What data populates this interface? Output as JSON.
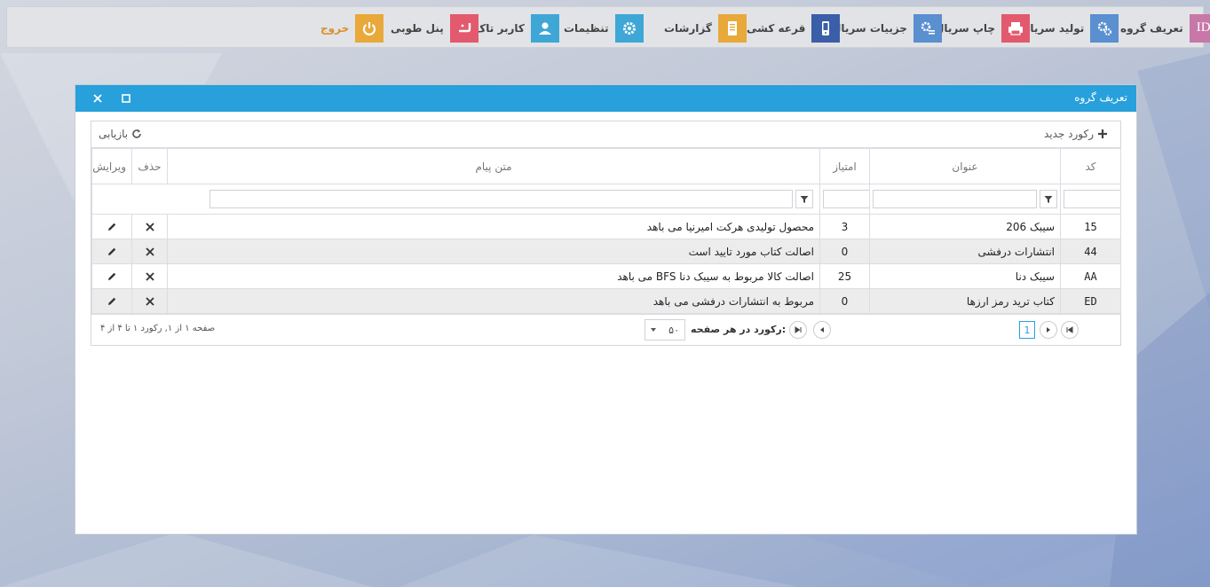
{
  "colors": {
    "window_title_bg": "#27a0dc",
    "exit_text": "#d8902a",
    "icon_group_def": "#c878a8",
    "icon_serial_prod": "#5a8fd0",
    "icon_serial_print": "#e35a6e",
    "icon_serial_details": "#5a8fd0",
    "icon_lottery": "#3a5fa8",
    "icon_reports": "#e8a93a",
    "icon_settings": "#3fa7d6",
    "icon_user": "#3fa7d6",
    "icon_panel": "#e35a6e",
    "icon_exit": "#e8a93a"
  },
  "toolbar": {
    "items": [
      {
        "key": "group",
        "label": "تعریف گروه",
        "icon": "id-card-icon"
      },
      {
        "key": "serialprod",
        "label": "تولید سریال",
        "icon": "gears-icon"
      },
      {
        "key": "serialprint",
        "label": "چاپ سریال",
        "icon": "printer-icon"
      },
      {
        "key": "serialdetails",
        "label": "جزییات سریال",
        "icon": "gears-list-icon"
      },
      {
        "key": "lottery",
        "label": "قرعه کشی",
        "icon": "mobile-icon"
      },
      {
        "key": "reports",
        "label": "گزارشات",
        "icon": "report-icon"
      },
      {
        "key": "settings",
        "label": "تنظیمات",
        "icon": "gear-icon"
      },
      {
        "key": "user",
        "label": "کاربر تاک",
        "icon": "user-icon"
      },
      {
        "key": "panel",
        "label": "پنل طوبی",
        "icon": "panel-logo-icon"
      },
      {
        "key": "exit",
        "label": "خروج",
        "icon": "power-icon"
      }
    ]
  },
  "window": {
    "title": "تعریف گروه"
  },
  "grid": {
    "new_record_label": "رکورد جدید",
    "refresh_label": "بازیابی",
    "columns": {
      "code": "کد",
      "title": "عنوان",
      "score": "امتیاز",
      "message": "متن پیام",
      "delete": "حذف",
      "edit": "ویرایش"
    },
    "rows": [
      {
        "code": "15",
        "title": "سیبک 206",
        "score": "3",
        "message": "محصول تولیدی هرکت امیرنیا می باهد"
      },
      {
        "code": "44",
        "title": "انتشارات درفشی",
        "score": "0",
        "message": "اصالت کتاب مورد تایید است"
      },
      {
        "code": "AA",
        "title": "سیبک دنا",
        "score": "25",
        "message": "اصالت کالا مربوط به سیبک دنا BFS می باهد"
      },
      {
        "code": "ED",
        "title": "کتاب ترید رمز ارزها",
        "score": "0",
        "message": "مربوط به انتشارات درفشی می باهد"
      }
    ]
  },
  "pager": {
    "current_page": "1",
    "per_page_label": "رکورد در هر صفحه:",
    "per_page_value": "۵۰",
    "summary": "صفحه ۱ از ۱, رکورد ۱ تا ۴ از ۴"
  }
}
